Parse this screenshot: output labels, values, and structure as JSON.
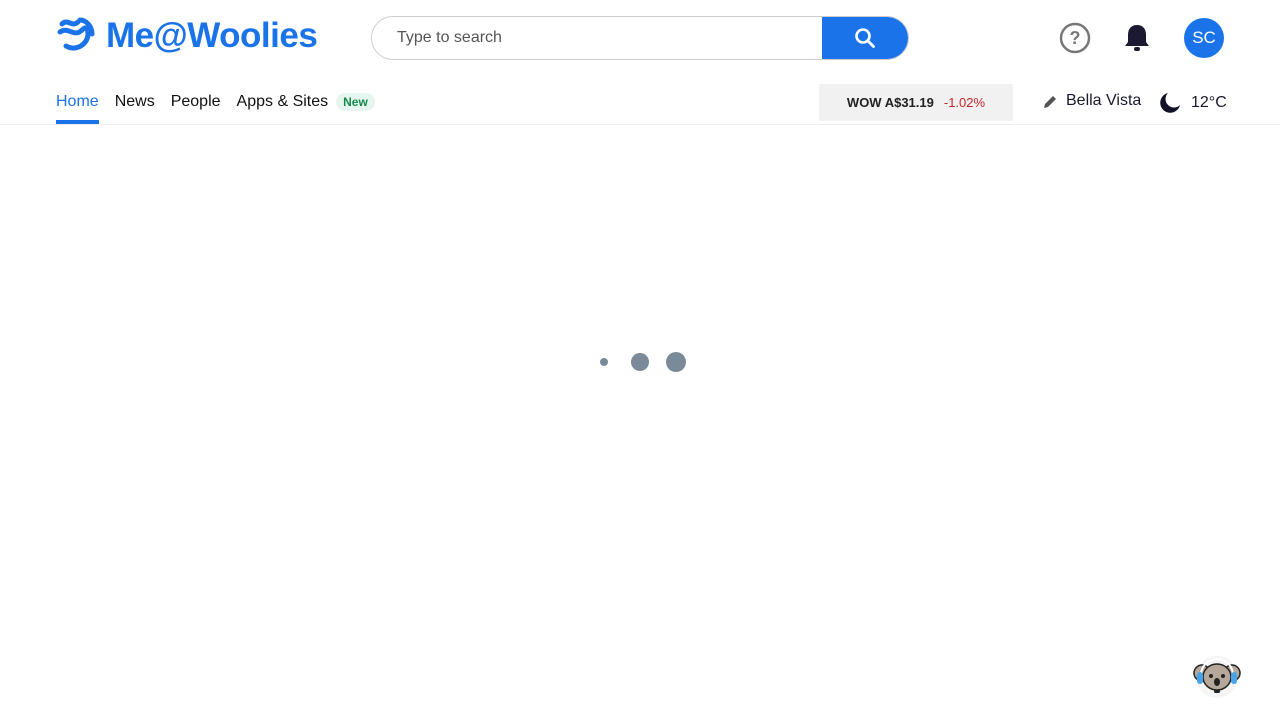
{
  "header": {
    "logo_text": "Me@Woolies",
    "search_placeholder": "Type to search",
    "avatar_initials": "SC"
  },
  "nav": {
    "items": [
      {
        "label": "Home",
        "active": true
      },
      {
        "label": "News"
      },
      {
        "label": "People"
      },
      {
        "label": "Apps & Sites",
        "badge": "New"
      }
    ]
  },
  "stock": {
    "symbol": "WOW A$31.19",
    "change": "-1.02%"
  },
  "location": "Bella Vista",
  "weather": {
    "temp": "12°C",
    "icon": "moon-icon"
  },
  "colors": {
    "brand": "#1a73e8",
    "negative": "#c62828"
  }
}
